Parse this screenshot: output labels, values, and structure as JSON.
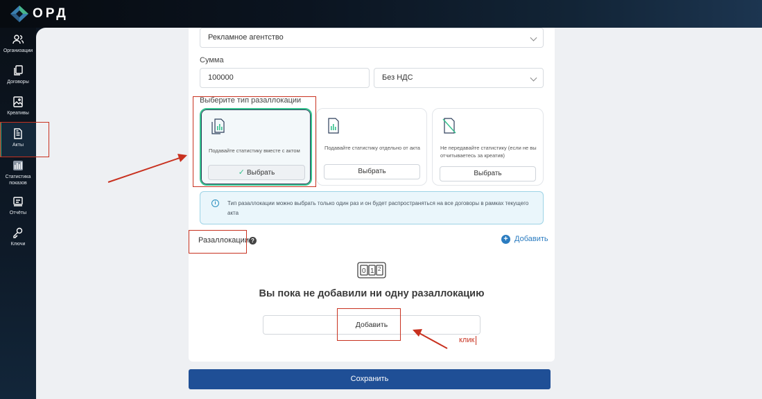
{
  "app": {
    "logo_text": "ОРД"
  },
  "sidebar": {
    "items": [
      {
        "label": "Организации",
        "icon": "users-icon"
      },
      {
        "label": "Договоры",
        "icon": "documents-icon"
      },
      {
        "label": "Креативы",
        "icon": "image-icon"
      },
      {
        "label": "Акты",
        "icon": "document-icon",
        "active": true
      },
      {
        "label": "Статистика показов",
        "icon": "bar-chart-icon"
      },
      {
        "label": "Отчёты",
        "icon": "report-icon"
      },
      {
        "label": "Ключи",
        "icon": "key-icon"
      }
    ]
  },
  "form": {
    "agency_select_value": "Рекламное агентство",
    "sum_label": "Сумма",
    "sum_value": "100000",
    "vat_select_value": "Без НДС",
    "realloc_type_label": "Выберите тип разаллокации",
    "options": [
      {
        "text": "Подавайте статистику вместе с актом",
        "button": "Выбрать",
        "selected": true
      },
      {
        "text": "Подавайте статистику отдельно от акта",
        "button": "Выбрать",
        "selected": false
      },
      {
        "text": "Не передавайте статистику (если не вы отчитываетесь за креатив)",
        "button": "Выбрать",
        "selected": false
      }
    ],
    "info_text": "Тип разаллокации можно выбрать только один раз и он будет распространяться на все договоры в рамках текущего акта",
    "reallocations_label": "Разаллокации",
    "add_link": "Добавить",
    "empty_title": "Вы пока не добавили ни одну разаллокацию",
    "empty_add_button": "Добавить",
    "save_button": "Сохранить"
  },
  "annotation": {
    "click_text": "клик"
  },
  "colors": {
    "accent_blue": "#1f4f96",
    "selected_green": "#36c28e",
    "annotation_red": "#c8311f"
  }
}
